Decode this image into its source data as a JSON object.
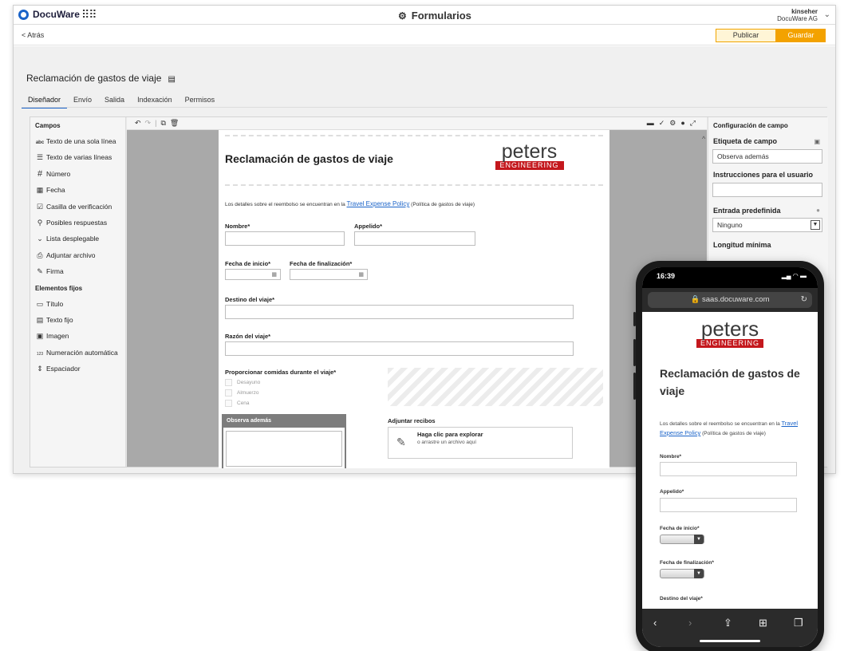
{
  "header": {
    "brand": "DocuWare",
    "app_title": "Formularios",
    "user_name": "kinseher",
    "user_org": "DocuWare AG"
  },
  "toolbar": {
    "back_label": "< Atrás",
    "publish_label": "Publicar",
    "save_label": "Guardar"
  },
  "page": {
    "form_title": "Reclamación de gastos de viaje"
  },
  "tabs": [
    "Diseñador",
    "Envío",
    "Salida",
    "Indexación",
    "Permisos"
  ],
  "fields_panel": {
    "heading": "Campos",
    "items": [
      {
        "icon": "abc",
        "label": "Texto de una sola línea"
      },
      {
        "icon": "☰",
        "label": "Texto de varias líneas"
      },
      {
        "icon": "#",
        "label": "Número"
      },
      {
        "icon": "▦",
        "label": "Fecha"
      },
      {
        "icon": "☑",
        "label": "Casilla de verificación"
      },
      {
        "icon": "⚲",
        "label": "Posibles respuestas"
      },
      {
        "icon": "⌄",
        "label": "Lista desplegable"
      },
      {
        "icon": "⎙",
        "label": "Adjuntar archivo"
      },
      {
        "icon": "✎",
        "label": "Firma"
      }
    ],
    "fixed_heading": "Elementos fijos",
    "fixed_items": [
      {
        "icon": "▭",
        "label": "Título"
      },
      {
        "icon": "▤",
        "label": "Texto fijo"
      },
      {
        "icon": "▣",
        "label": "Imagen"
      },
      {
        "icon": "123",
        "label": "Numeración automática"
      },
      {
        "icon": "⇕",
        "label": "Espaciador"
      }
    ]
  },
  "canvas": {
    "title": "Reclamación de gastos de viaje",
    "logo_main": "peters",
    "logo_sub": "ENGINEERING",
    "desc_prefix": "Los detalles sobre el reembolso se encuentran en la",
    "desc_link": "Travel Expense Policy",
    "desc_suffix": "(Política de gastos de viaje)",
    "label_nombre": "Nombre*",
    "label_apellido": "Appelido*",
    "label_fecha_inicio": "Fecha de inicio*",
    "label_fecha_fin": "Fecha de finalización*",
    "label_destino": "Destino del viaje*",
    "label_razon": "Razón del viaje*",
    "label_comidas": "Proporcionar comidas durante el viaje*",
    "comidas_options": [
      "Desayuno",
      "Almuerzo",
      "Cena"
    ],
    "observa_header": "Observa además",
    "adjuntar_label": "Adjuntar recibos",
    "upload_title": "Haga clic para explorar",
    "upload_sub": "o arrastre un archivo aquí"
  },
  "config_panel": {
    "heading": "Configuración de campo",
    "etiqueta_label": "Etiqueta de campo",
    "etiqueta_value": "Observa además",
    "instrucciones_label": "Instrucciones para el usuario",
    "instrucciones_value": "",
    "entrada_label": "Entrada predefinida",
    "entrada_value": "Ninguno",
    "longitud_label": "Longitud mínima"
  },
  "phone": {
    "time": "16:39",
    "url": "saas.docuware.com",
    "title": "Reclamación de gastos de viaje",
    "logo_main": "peters",
    "logo_sub": "ENGINEERING",
    "desc_prefix": "Los detalles sobre el reembolso se encuentran en la",
    "desc_link": "Travel Expense Policy",
    "desc_suffix": "(Política de gastos de viaje)",
    "label_nombre": "Nombre*",
    "label_apellido": "Appelido*",
    "label_fecha_inicio": "Fecha de inicio*",
    "label_fecha_fin": "Fecha de finalización*",
    "label_destino": "Destino del viaje*"
  }
}
